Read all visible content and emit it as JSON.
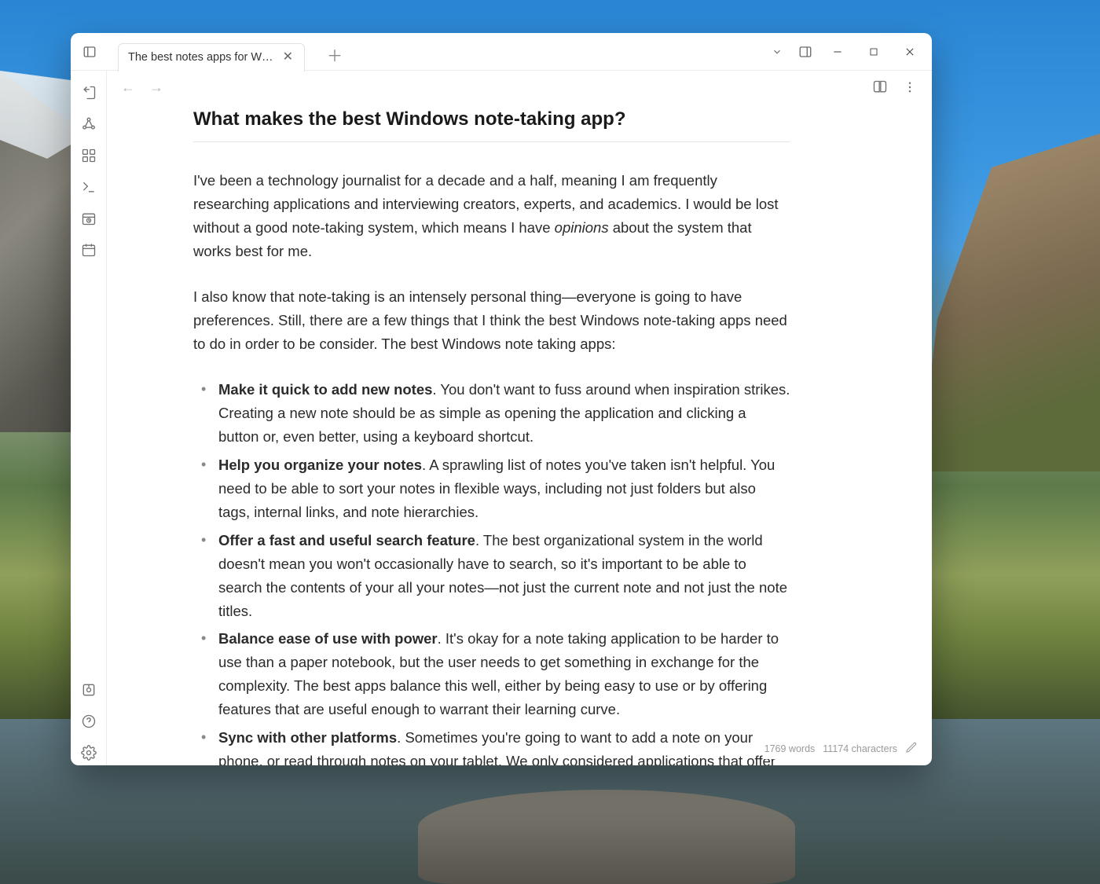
{
  "tab": {
    "title": "The best notes apps for W…"
  },
  "document": {
    "heading": "What makes the best Windows note-taking app?",
    "para1_a": "I've been a technology journalist for a decade and a half, meaning I am frequently researching applications and interviewing creators, experts, and academics. I would be lost without a good note-taking system, which means I have ",
    "para1_em": "opinions",
    "para1_b": " about the system that works best for me.",
    "para2": "I also know that note-taking is an intensely personal thing—everyone is going to have preferences. Still, there are a few things that I think the best Windows note-taking apps need to do in order to be consider. The best Windows note taking apps:",
    "bullets": [
      {
        "title": "Make it quick to add new notes",
        "rest": ". You don't want to fuss around when inspiration strikes. Creating a new note should be as simple as opening the application and clicking a button or, even better, using a keyboard shortcut."
      },
      {
        "title": "Help you organize your notes",
        "rest": ". A sprawling list of notes you've taken isn't helpful. You need to be able to sort your notes in flexible ways, including not just folders but also tags, internal links, and note hierarchies."
      },
      {
        "title": "Offer a fast and useful search feature",
        "rest": ". The best organizational system in the world doesn't mean you won't occasionally have to search, so it's important to be able to search the contents of your all your notes—not just the current note and not just the note titles."
      },
      {
        "title": "Balance ease of use with power",
        "rest": ". It's okay for a note taking application to be harder to use than a paper notebook, but the user needs to get something in exchange for the complexity. The best apps balance this well, either by being easy to use or by offering features that are useful enough to warrant their learning curve."
      },
      {
        "title": "Sync with other platforms",
        "rest": ". Sometimes you're going to want to add a note on your phone, or read through notes on your tablet. We only considered applications that offer some kind of syncing ability."
      }
    ]
  },
  "status": {
    "words": "1769 words",
    "chars": "11174 characters"
  }
}
